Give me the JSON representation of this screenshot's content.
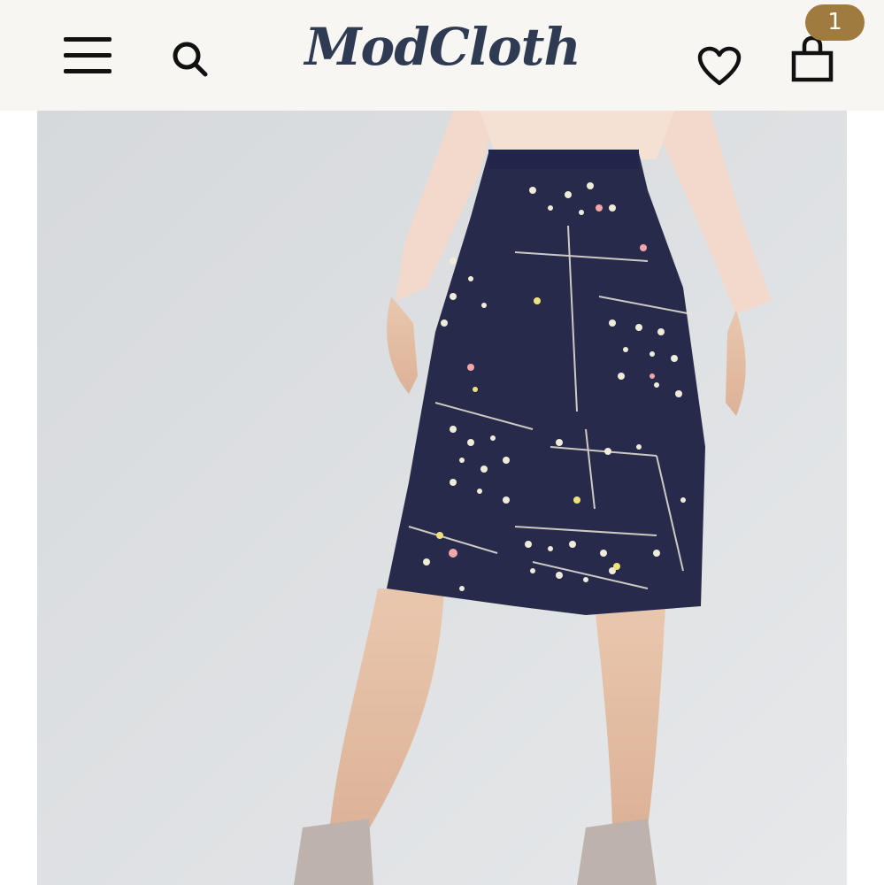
{
  "header": {
    "logo_text": "ModCloth",
    "cart_count": "1",
    "icons": {
      "menu": "menu-icon",
      "search": "search-icon",
      "wishlist": "heart-icon",
      "cart": "shopping-bag-icon"
    }
  },
  "product": {
    "image_description_icon": "product-photo"
  },
  "colors": {
    "header_bg": "#f8f6f3",
    "logo": "#2f3b52",
    "badge": "#a07b3f",
    "skirt": "#26294a",
    "blouse": "#f3dcd0"
  }
}
